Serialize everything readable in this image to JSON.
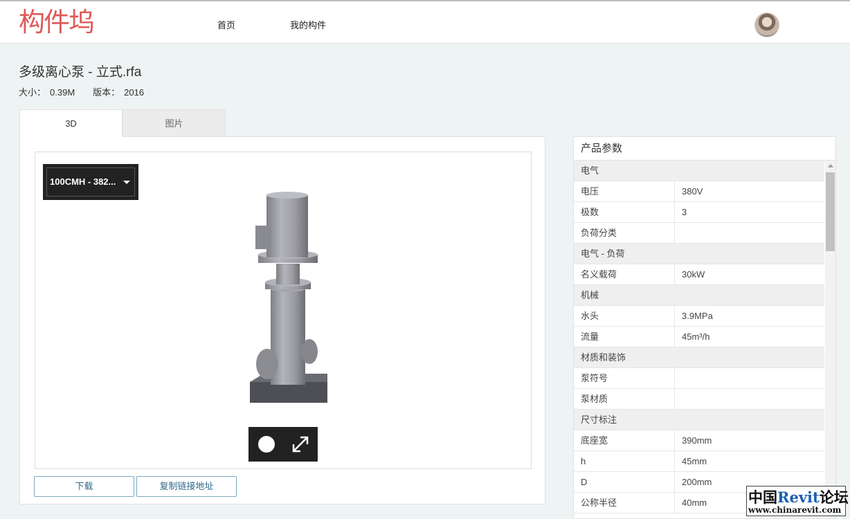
{
  "header": {
    "logo": "构件坞",
    "nav": [
      "首页",
      "我的构件"
    ]
  },
  "file": {
    "title": "多级离心泵 - 立式.rfa",
    "size_label": "大小：",
    "size": "0.39M",
    "version_label": "版本：",
    "version": "2016"
  },
  "tabs": [
    "3D",
    "图片"
  ],
  "viewer": {
    "dropdown_value": "100CMH - 382...",
    "play_icon": "circle-icon",
    "fullscreen_icon": "expand-icon"
  },
  "actions": {
    "download": "下载",
    "copy_link": "复制链接地址"
  },
  "params": {
    "title": "产品参数",
    "rows": [
      {
        "type": "group",
        "label": "电气"
      },
      {
        "type": "item",
        "key": "电压",
        "value": "380V"
      },
      {
        "type": "item",
        "key": "极数",
        "value": "3"
      },
      {
        "type": "item",
        "key": "负荷分类",
        "value": ""
      },
      {
        "type": "group",
        "label": "电气 - 负荷"
      },
      {
        "type": "item",
        "key": "名义载荷",
        "value": "30kW"
      },
      {
        "type": "group",
        "label": "机械"
      },
      {
        "type": "item",
        "key": "水头",
        "value": "3.9MPa"
      },
      {
        "type": "item",
        "key": "流量",
        "value": "45m³/h"
      },
      {
        "type": "group",
        "label": "材质和装饰"
      },
      {
        "type": "item",
        "key": "泵符号",
        "value": ""
      },
      {
        "type": "item",
        "key": "泵材质",
        "value": ""
      },
      {
        "type": "group",
        "label": "尺寸标注"
      },
      {
        "type": "item",
        "key": "底座宽",
        "value": "390mm"
      },
      {
        "type": "item",
        "key": "h",
        "value": "45mm"
      },
      {
        "type": "item",
        "key": "D",
        "value": "200mm"
      },
      {
        "type": "item",
        "key": "公称半径",
        "value": "40mm"
      }
    ]
  },
  "watermark": {
    "line1_a": "中国",
    "line1_b": "Revit",
    "line1_c": "论坛",
    "line2": "www.chinarevit.com"
  },
  "colors": {
    "logo": "#e05a5a",
    "button_text": "#2f6b8a",
    "button_border": "#78a9c0"
  }
}
